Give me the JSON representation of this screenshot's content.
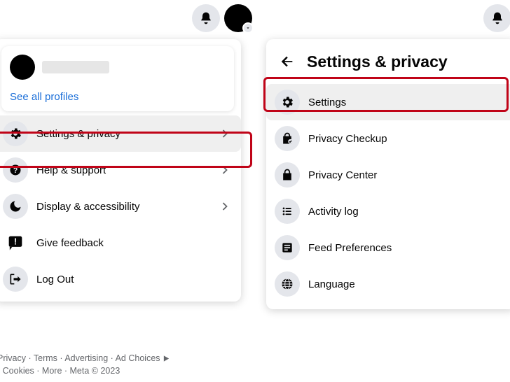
{
  "left": {
    "see_all": "See all profiles",
    "menu": {
      "settings_privacy": "Settings & privacy",
      "help_support": "Help & support",
      "display_accessibility": "Display & accessibility",
      "give_feedback": "Give feedback",
      "log_out": "Log Out"
    },
    "footer": {
      "privacy": "Privacy",
      "terms": "Terms",
      "advertising": "Advertising",
      "ad_choices": "Ad Choices",
      "cookies": "Cookies",
      "more": "More",
      "meta": "Meta © 2023",
      "sep": " · "
    }
  },
  "right": {
    "title": "Settings & privacy",
    "menu": {
      "settings": "Settings",
      "privacy_checkup": "Privacy Checkup",
      "privacy_center": "Privacy Center",
      "activity_log": "Activity log",
      "feed_preferences": "Feed Preferences",
      "language": "Language"
    }
  }
}
